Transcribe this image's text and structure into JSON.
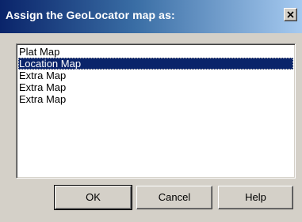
{
  "window": {
    "title": "Assign the GeoLocator map as:"
  },
  "list": {
    "items": [
      {
        "label": "Plat Map",
        "selected": false
      },
      {
        "label": "Location Map",
        "selected": true
      },
      {
        "label": "Extra Map",
        "selected": false
      },
      {
        "label": "Extra Map",
        "selected": false
      },
      {
        "label": "Extra Map",
        "selected": false
      }
    ]
  },
  "buttons": {
    "ok_label": "OK",
    "cancel_label": "Cancel",
    "help_label": "Help"
  },
  "icons": {
    "close": "close-icon"
  },
  "colors": {
    "title_bar_start": "#0a246a",
    "title_bar_end": "#a6caf0",
    "selection": "#0a246a",
    "face": "#d4d0c8"
  }
}
